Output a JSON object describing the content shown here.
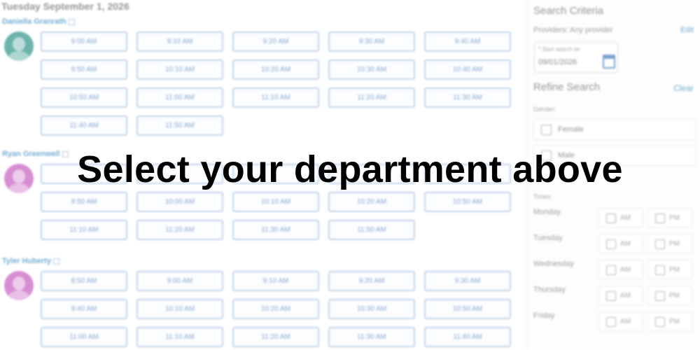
{
  "schedule": {
    "date_heading": "Tuesday September 1, 2026",
    "providers": [
      {
        "name": "Daniella Granrath",
        "avatar_color": "#13877a",
        "slots": [
          "9:00 AM",
          "9:10 AM",
          "9:20 AM",
          "9:30 AM",
          "9:40 AM",
          "9:50 AM",
          "10:10 AM",
          "10:20 AM",
          "10:30 AM",
          "10:40 AM",
          "10:50 AM",
          "11:00 AM",
          "11:10 AM",
          "11:20 AM",
          "11:30 AM",
          "11:40 AM",
          "11:50 AM"
        ]
      },
      {
        "name": "Ryan Greenwell",
        "avatar_color": "#c048b6",
        "slots": [
          "",
          "",
          "",
          "",
          "",
          "9:50 AM",
          "10:00 AM",
          "10:10 AM",
          "10:20 AM",
          "10:50 AM",
          "11:10 AM",
          "11:20 AM",
          "11:30 AM",
          "11:50 AM"
        ]
      },
      {
        "name": "Tyler Huberty",
        "avatar_color": "#c048b6",
        "slots": [
          "8:50 AM",
          "9:00 AM",
          "9:10 AM",
          "9:20 AM",
          "9:30 AM",
          "9:40 AM",
          "10:10 AM",
          "10:20 AM",
          "10:30 AM",
          "10:50 AM",
          "11:00 AM",
          "11:10 AM",
          "11:20 AM",
          "11:30 AM",
          "11:40 AM"
        ]
      }
    ]
  },
  "sidebar": {
    "title": "Search Criteria",
    "providers_text": "Providers: Any provider",
    "edit_label": "Edit",
    "start_date_label": "Start search on",
    "start_date_value": "09/01/2026",
    "refine_title": "Refine Search",
    "clear_label": "Clear",
    "gender_label": "Gender:",
    "gender_options": [
      "Female",
      "Male"
    ],
    "times_label": "Times:",
    "am_label": "AM",
    "pm_label": "PM",
    "days": [
      "Monday",
      "Tuesday",
      "Wednesday",
      "Thursday",
      "Friday"
    ]
  },
  "overlay": {
    "message": "Select your department above"
  },
  "colors": {
    "link": "#1b78b8",
    "slot_border": "#9cb9de",
    "overlay_text": "#000000"
  }
}
